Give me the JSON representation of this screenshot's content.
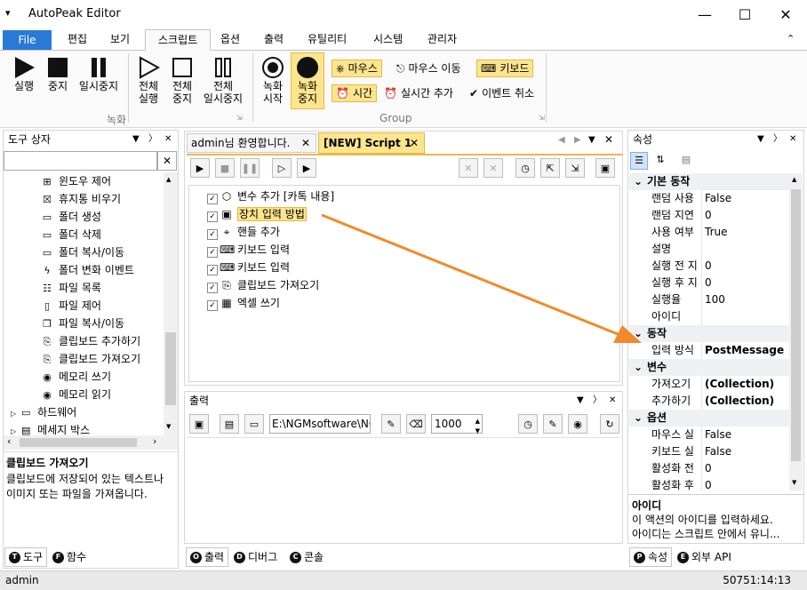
{
  "app": {
    "title": "AutoPeak Editor",
    "sysmenu_glyph": "▾"
  },
  "window_controls": {
    "minimize": "—",
    "maximize": "☐",
    "close": "✕"
  },
  "ribbon_tabs": {
    "file": "File",
    "edit": "편집",
    "view": "보기",
    "script": "스크립트",
    "options": "옵션",
    "output": "출력",
    "utility": "유틸리티",
    "system": "시스템",
    "admin": "관리자",
    "collapse": "⌃"
  },
  "ribbon": {
    "run": "실행",
    "stop": "중지",
    "pause": "일시중지",
    "all_run": [
      "전체",
      "실행"
    ],
    "all_stop": [
      "전체",
      "중지"
    ],
    "all_pause": [
      "전체",
      "일시중지"
    ],
    "rec_start": [
      "녹화",
      "시작"
    ],
    "rec_stop": [
      "녹화",
      "중지"
    ],
    "mouse": "마우스",
    "mouse_move": "마우스 이동",
    "keyboard": "키보드",
    "time": "시간",
    "realtime_add": "실시간 추가",
    "event_cancel": "이벤트 취소",
    "group_record": "녹화",
    "group_group": "Group"
  },
  "toolbox": {
    "title": "도구 상자",
    "items": [
      {
        "icon": "windows-icon",
        "glyph": "⊞",
        "label": "윈도우 제어"
      },
      {
        "icon": "trash-icon",
        "glyph": "☒",
        "label": "휴지통 비우기"
      },
      {
        "icon": "folder-add-icon",
        "glyph": "▭",
        "label": "폴더 생성"
      },
      {
        "icon": "folder-delete-icon",
        "glyph": "▭",
        "label": "폴더 삭제"
      },
      {
        "icon": "folder-copy-icon",
        "glyph": "▭",
        "label": "폴더 복사/이동"
      },
      {
        "icon": "lightning-icon",
        "glyph": "ϟ",
        "label": "폴더 변화 이벤트"
      },
      {
        "icon": "file-list-icon",
        "glyph": "☷",
        "label": "파일 목록"
      },
      {
        "icon": "file-icon",
        "glyph": "▯",
        "label": "파일 제어"
      },
      {
        "icon": "file-copy-icon",
        "glyph": "❐",
        "label": "파일 복사/이동"
      },
      {
        "icon": "clipboard-add-icon",
        "glyph": "⎘",
        "label": "클립보드 추가하기"
      },
      {
        "icon": "clipboard-get-icon",
        "glyph": "⎘",
        "label": "클립보드 가져오기"
      },
      {
        "icon": "memory-write-icon",
        "glyph": "◉",
        "label": "메모리 쓰기"
      },
      {
        "icon": "memory-read-icon",
        "glyph": "◉",
        "label": "메모리 읽기"
      }
    ],
    "groups": [
      {
        "icon": "monitor-icon",
        "glyph": "▭",
        "label": "하드웨어"
      },
      {
        "icon": "message-icon",
        "glyph": "▤",
        "label": "메세지 박스"
      }
    ],
    "desc_title": "클립보드 가져오기",
    "desc_text": "클립보드에 저장되어 있는 텍스트나 이미지 또는 파일을 가져옵니다.",
    "tab_tools": "도구",
    "tab_functions": "함수"
  },
  "editor": {
    "tab_welcome": "admin님 환영합니다.",
    "tab_script": "[NEW] Script 1",
    "lines": [
      {
        "icon": "box-icon",
        "glyph": "⬡",
        "label": "변수 추가 [카톡 내용]",
        "selected": false
      },
      {
        "icon": "input-icon",
        "glyph": "▣",
        "label": "장치 입력 방법",
        "selected": true
      },
      {
        "icon": "crosshair-icon",
        "glyph": "⌖",
        "label": "핸들 추가",
        "selected": false
      },
      {
        "icon": "keyboard-icon",
        "glyph": "⌨",
        "label": "키보드 입력",
        "selected": false
      },
      {
        "icon": "keyboard-icon",
        "glyph": "⌨",
        "label": "키보드 입력",
        "selected": false
      },
      {
        "icon": "clipboard-icon",
        "glyph": "⎘",
        "label": "클립보드 가져오기",
        "selected": false
      },
      {
        "icon": "excel-icon",
        "glyph": "▦",
        "label": "엑셀 쓰기",
        "selected": false
      }
    ]
  },
  "output": {
    "title": "출력",
    "path": "E:\\NGMsoftware\\NG",
    "count": "1000",
    "tab_output": "출력",
    "tab_debug": "디버그",
    "tab_console": "콘솔"
  },
  "properties": {
    "title": "속성",
    "categories": [
      {
        "name": "기본 동작",
        "rows": [
          {
            "k": "랜덤 사용",
            "v": "False",
            "bold": false
          },
          {
            "k": "랜덤 지연",
            "v": "0",
            "bold": false
          },
          {
            "k": "사용 여부",
            "v": "True",
            "bold": false
          },
          {
            "k": "설명",
            "v": "",
            "bold": false
          },
          {
            "k": "실행 전 지",
            "v": "0",
            "bold": false
          },
          {
            "k": "실행 후 지",
            "v": "0",
            "bold": false
          },
          {
            "k": "실행율",
            "v": "100",
            "bold": false
          },
          {
            "k": "아이디",
            "v": "",
            "bold": false
          }
        ]
      },
      {
        "name": "동작",
        "rows": [
          {
            "k": "입력 방식",
            "v": "PostMessage",
            "bold": true
          }
        ]
      },
      {
        "name": "변수",
        "rows": [
          {
            "k": "가져오기",
            "v": "(Collection)",
            "bold": true
          },
          {
            "k": "추가하기",
            "v": "(Collection)",
            "bold": true
          }
        ]
      },
      {
        "name": "옵션",
        "rows": [
          {
            "k": "마우스 실",
            "v": "False",
            "bold": false
          },
          {
            "k": "키보드 실",
            "v": "False",
            "bold": false
          },
          {
            "k": "활성화 전",
            "v": "0",
            "bold": false
          },
          {
            "k": "활성화 후",
            "v": "0",
            "bold": false
          }
        ]
      }
    ],
    "desc_title": "아이디",
    "desc_line1": "이 액션의 아이디를 입력하세요.",
    "desc_line2": "아이디는 스크립트 안에서 유니...",
    "tab_properties": "속성",
    "tab_api": "외부 API"
  },
  "status": {
    "user": "admin",
    "time": "50751:14:13"
  },
  "colors": {
    "accent": "#2b79d7",
    "highlight": "#fde58d",
    "arrow": "#f08a2c"
  }
}
